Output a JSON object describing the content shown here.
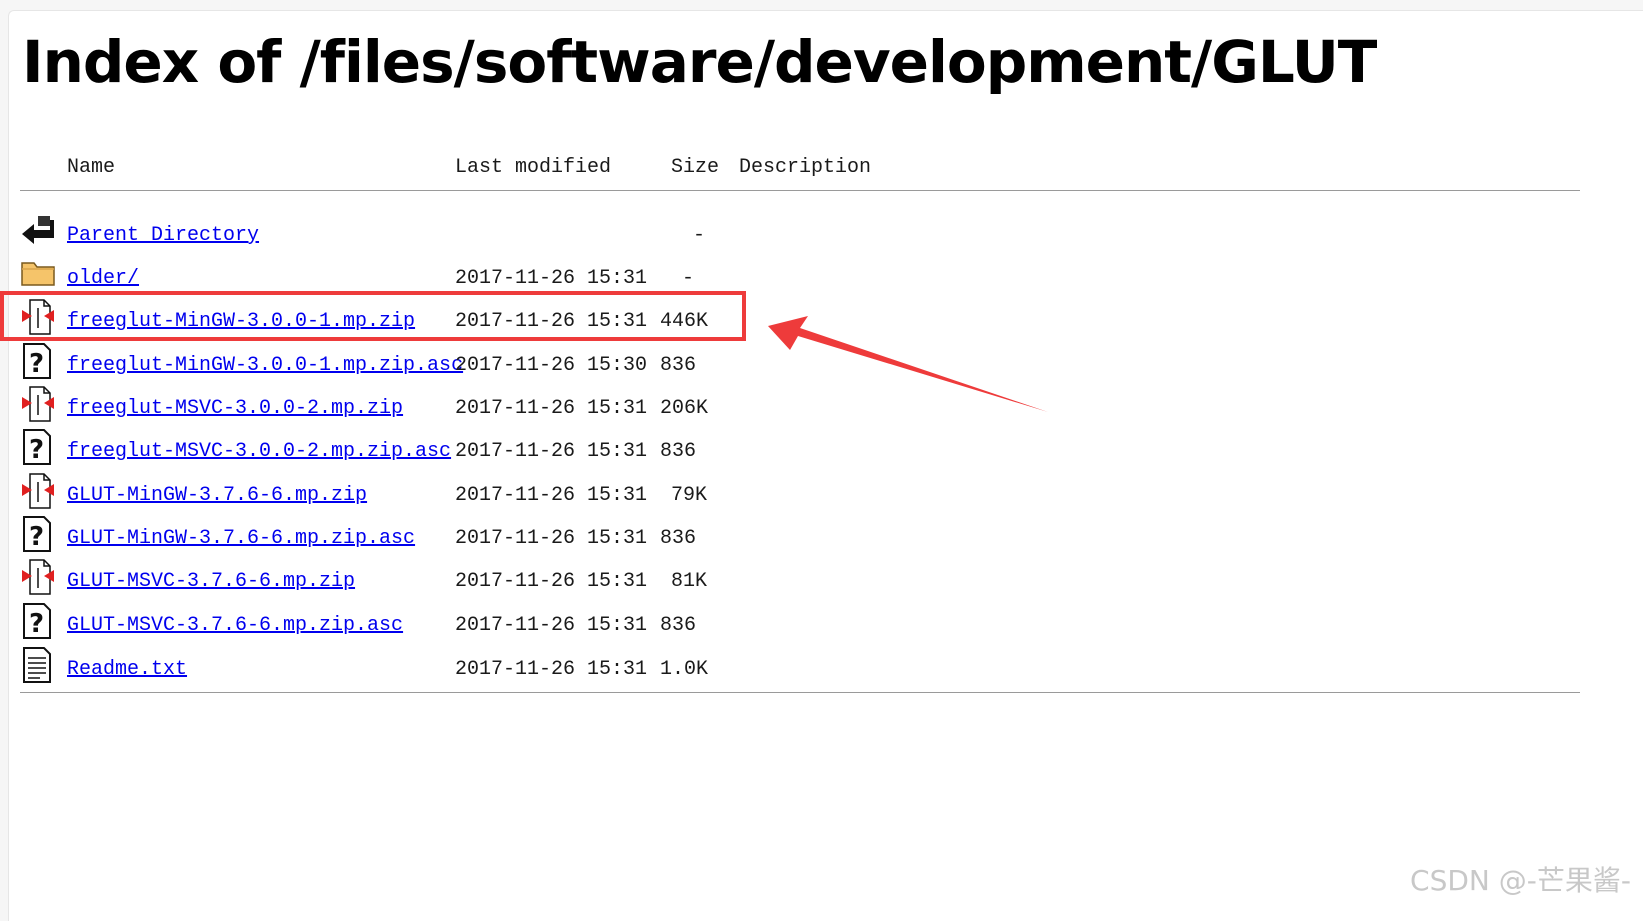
{
  "page": {
    "title": "Index of /files/software/development/GLUT"
  },
  "columns": {
    "name": "Name",
    "last_modified": "Last modified",
    "size": "Size",
    "description": "Description"
  },
  "entries": [
    {
      "icon": "back-icon",
      "name": "Parent Directory",
      "date": "",
      "size": "-"
    },
    {
      "icon": "folder-icon",
      "name": "older/",
      "date": "2017-11-26 15:31",
      "size": "-"
    },
    {
      "icon": "archive-icon",
      "name": "freeglut-MinGW-3.0.0-1.mp.zip",
      "date": "2017-11-26 15:31",
      "size": "446K"
    },
    {
      "icon": "unknown-file-icon",
      "name": "freeglut-MinGW-3.0.0-1.mp.zip.asc",
      "date": "2017-11-26 15:30",
      "size": "836"
    },
    {
      "icon": "archive-icon",
      "name": "freeglut-MSVC-3.0.0-2.mp.zip",
      "date": "2017-11-26 15:31",
      "size": "206K"
    },
    {
      "icon": "unknown-file-icon",
      "name": "freeglut-MSVC-3.0.0-2.mp.zip.asc",
      "date": "2017-11-26 15:31",
      "size": "836"
    },
    {
      "icon": "archive-icon",
      "name": "GLUT-MinGW-3.7.6-6.mp.zip",
      "date": "2017-11-26 15:31",
      "size": "79K"
    },
    {
      "icon": "unknown-file-icon",
      "name": "GLUT-MinGW-3.7.6-6.mp.zip.asc",
      "date": "2017-11-26 15:31",
      "size": "836"
    },
    {
      "icon": "archive-icon",
      "name": "GLUT-MSVC-3.7.6-6.mp.zip",
      "date": "2017-11-26 15:31",
      "size": "81K"
    },
    {
      "icon": "unknown-file-icon",
      "name": "GLUT-MSVC-3.7.6-6.mp.zip.asc",
      "date": "2017-11-26 15:31",
      "size": "836"
    },
    {
      "icon": "text-file-icon",
      "name": "Readme.txt",
      "date": "2017-11-26 15:31",
      "size": "1.0K"
    }
  ],
  "annotation": {
    "highlighted_entry": "freeglut-MinGW-3.0.0-1.mp.zip",
    "color": "#ee3b3b"
  },
  "watermark": "CSDN @-芒果酱-",
  "colors": {
    "link": "#0000ee",
    "highlight": "#ee3b3b"
  }
}
